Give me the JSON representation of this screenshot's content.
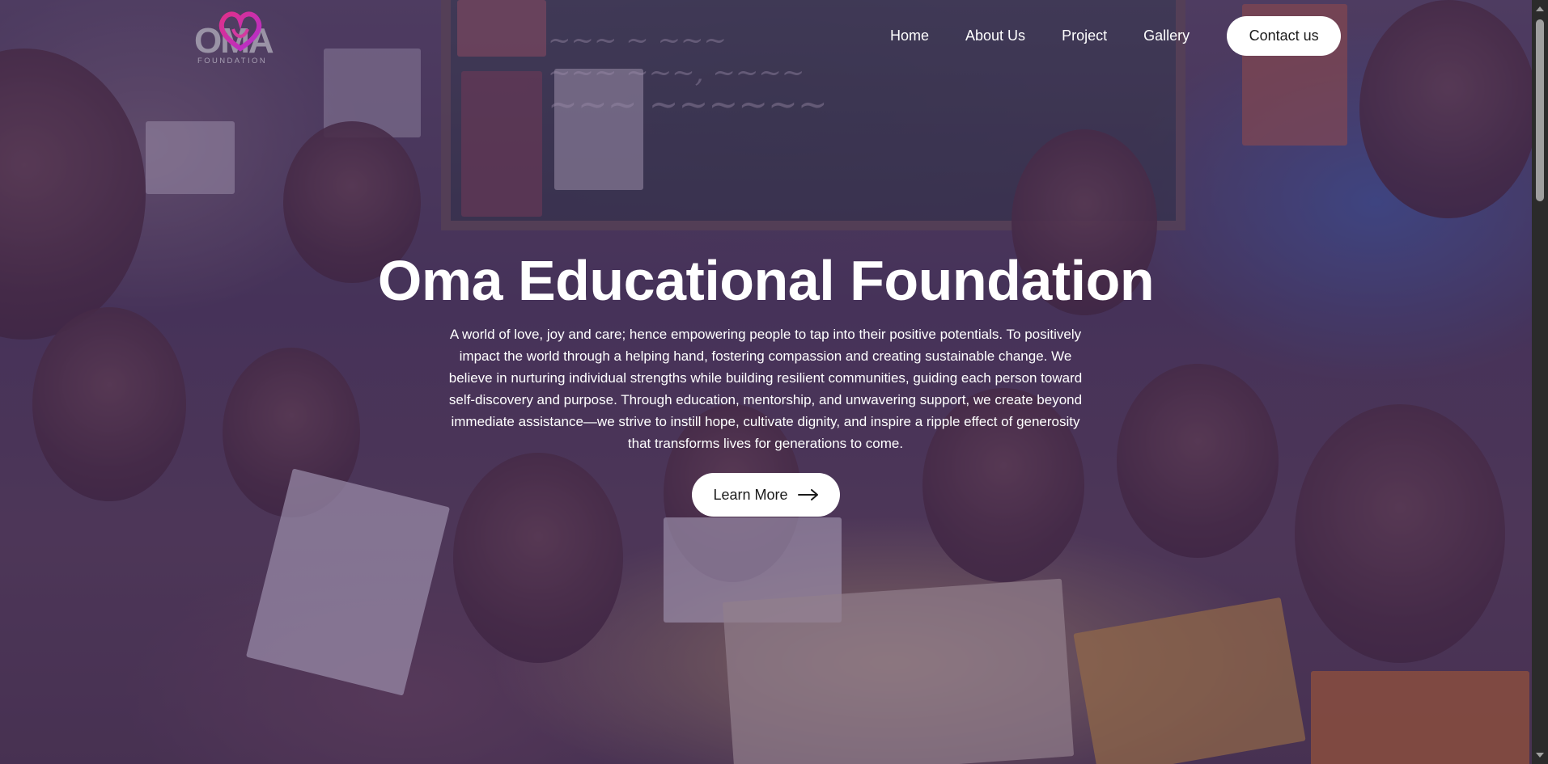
{
  "brand": {
    "logo_letters": "OMA",
    "logo_subtitle": "FOUNDATION",
    "logo_heart_colors": [
      "#e0308a",
      "#b12fd0"
    ]
  },
  "nav": {
    "items": [
      {
        "label": "Home"
      },
      {
        "label": "About Us"
      },
      {
        "label": "Project"
      },
      {
        "label": "Gallery"
      }
    ],
    "contact_label": "Contact us"
  },
  "hero": {
    "title": "Oma Educational Foundation",
    "description": "A world of love, joy and care; hence empowering people to tap into their positive potentials. To positively impact the world through a helping hand, fostering compassion and creating sustainable change. We believe in nurturing individual strengths while building resilient communities, guiding each person toward self-discovery and purpose. Through education, mentorship, and unwavering support, we create beyond immediate assistance—we strive to instill hope, cultivate dignity, and inspire a ripple effect of generosity that transforms lives for generations to come.",
    "cta_label": "Learn More",
    "cta_icon": "arrow-right-icon",
    "overlay_color": "#3e2458",
    "background_image": "children-reading-classroom-photo"
  },
  "scrollbar": {
    "position_fraction": 0.0
  }
}
